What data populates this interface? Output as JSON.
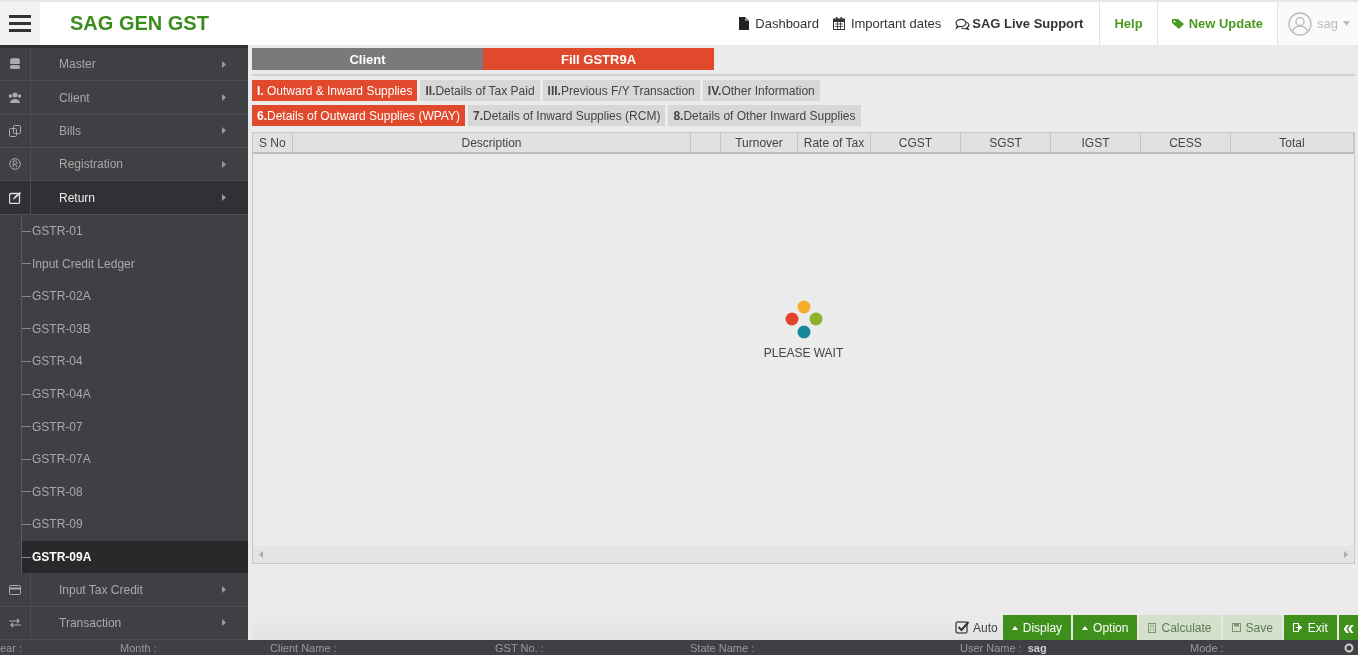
{
  "header": {
    "title": "SAG GEN GST",
    "links": [
      {
        "label": "Dashboard",
        "kind": "page"
      },
      {
        "label": "Important dates",
        "kind": "calendar"
      },
      {
        "label": "SAG Live Support",
        "kind": "chat"
      }
    ],
    "help": "Help",
    "new_update": "New Update",
    "user": "sag"
  },
  "sidebar": {
    "items": [
      {
        "label": "Master",
        "kind": "database",
        "expanded": false
      },
      {
        "label": "Client",
        "kind": "users",
        "expanded": false
      },
      {
        "label": "Bills",
        "kind": "bills",
        "expanded": false
      },
      {
        "label": "Registration",
        "kind": "registered",
        "expanded": false
      },
      {
        "label": "Return",
        "kind": "edit",
        "expanded": true,
        "children": [
          {
            "label": "GSTR-01",
            "selected": false
          },
          {
            "label": "Input Credit Ledger",
            "selected": false
          },
          {
            "label": "GSTR-02A",
            "selected": false
          },
          {
            "label": "GSTR-03B",
            "selected": false
          },
          {
            "label": "GSTR-04",
            "selected": false
          },
          {
            "label": "GSTR-04A",
            "selected": false
          },
          {
            "label": "GSTR-07",
            "selected": false
          },
          {
            "label": "GSTR-07A",
            "selected": false
          },
          {
            "label": "GSTR-08",
            "selected": false
          },
          {
            "label": "GSTR-09",
            "selected": false
          },
          {
            "label": "GSTR-09A",
            "selected": true
          }
        ]
      },
      {
        "label": "Input Tax Credit",
        "kind": "card",
        "expanded": false
      },
      {
        "label": "Transaction",
        "kind": "exchange",
        "expanded": false
      }
    ]
  },
  "top_tabs": [
    {
      "label": "Client",
      "selected": false
    },
    {
      "label": "Fill GSTR9A",
      "selected": true
    }
  ],
  "section_tabs": [
    {
      "label": "**I.** Outward & Inward Supplies",
      "selected": true
    },
    {
      "label": "**II.**Details of Tax Paid",
      "selected": false
    },
    {
      "label": "**III.**Previous F/Y Transaction",
      "selected": false
    },
    {
      "label": "**IV.**Other Information",
      "selected": false
    }
  ],
  "sub_tabs": [
    {
      "label": "**6.**Details of Outward Supplies (WPAY)",
      "selected": true
    },
    {
      "label": "**7.**Details of Inward Supplies (RCM)",
      "selected": false
    },
    {
      "label": "**8.**Details of Other Inward Supplies",
      "selected": false
    }
  ],
  "table": {
    "columns": [
      "S No",
      "Description",
      "Turnover",
      "Rate of Tax",
      "CGST",
      "SGST",
      "IGST",
      "CESS",
      "Total"
    ]
  },
  "loading": {
    "text": "PLEASE WAIT"
  },
  "toolbar": {
    "auto": {
      "label": "Auto",
      "checked": true
    },
    "buttons": [
      {
        "label": "Display",
        "kind": "caret",
        "disabled": false
      },
      {
        "label": "Option",
        "kind": "caret",
        "disabled": false
      },
      {
        "label": "Calculate",
        "kind": "calc",
        "disabled": true
      },
      {
        "label": "Save",
        "kind": "save",
        "disabled": true
      },
      {
        "label": "Exit",
        "kind": "exit",
        "disabled": false
      },
      {
        "label": "«",
        "kind": "plain",
        "disabled": false
      }
    ]
  },
  "status_bar": {
    "fields": [
      {
        "label": "ear :"
      },
      {
        "label": "Month :"
      },
      {
        "label": "Client Name :"
      },
      {
        "label": "GST No. :"
      },
      {
        "label": "State Name :"
      },
      {
        "label": "User Name :",
        "value": "sag"
      },
      {
        "label": "Mode :"
      }
    ]
  }
}
